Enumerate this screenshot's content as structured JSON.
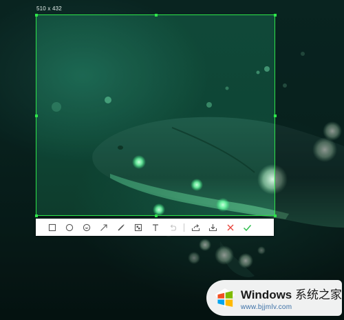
{
  "screenshot": {
    "selection_size_label": "510 x 432",
    "accent_color": "#2ee64a",
    "toolbar": [
      {
        "id": "rectangle",
        "icon": "rectangle-icon"
      },
      {
        "id": "ellipse",
        "icon": "ellipse-icon"
      },
      {
        "id": "mosaic",
        "icon": "mosaic-icon"
      },
      {
        "id": "arrow",
        "icon": "arrow-icon"
      },
      {
        "id": "pen",
        "icon": "pen-icon"
      },
      {
        "id": "blur",
        "icon": "blur-icon"
      },
      {
        "id": "text",
        "icon": "text-icon"
      },
      {
        "id": "undo",
        "icon": "undo-icon",
        "disabled": true
      },
      {
        "id": "share",
        "icon": "share-icon"
      },
      {
        "id": "save",
        "icon": "download-icon"
      },
      {
        "id": "cancel",
        "icon": "close-icon",
        "color": "#e8453c"
      },
      {
        "id": "confirm",
        "icon": "checkmark-icon",
        "color": "#2fbf4f"
      }
    ]
  },
  "watermark": {
    "brand": "Windows",
    "suffix": "系统之家",
    "url": "www.bjjmlv.com"
  }
}
